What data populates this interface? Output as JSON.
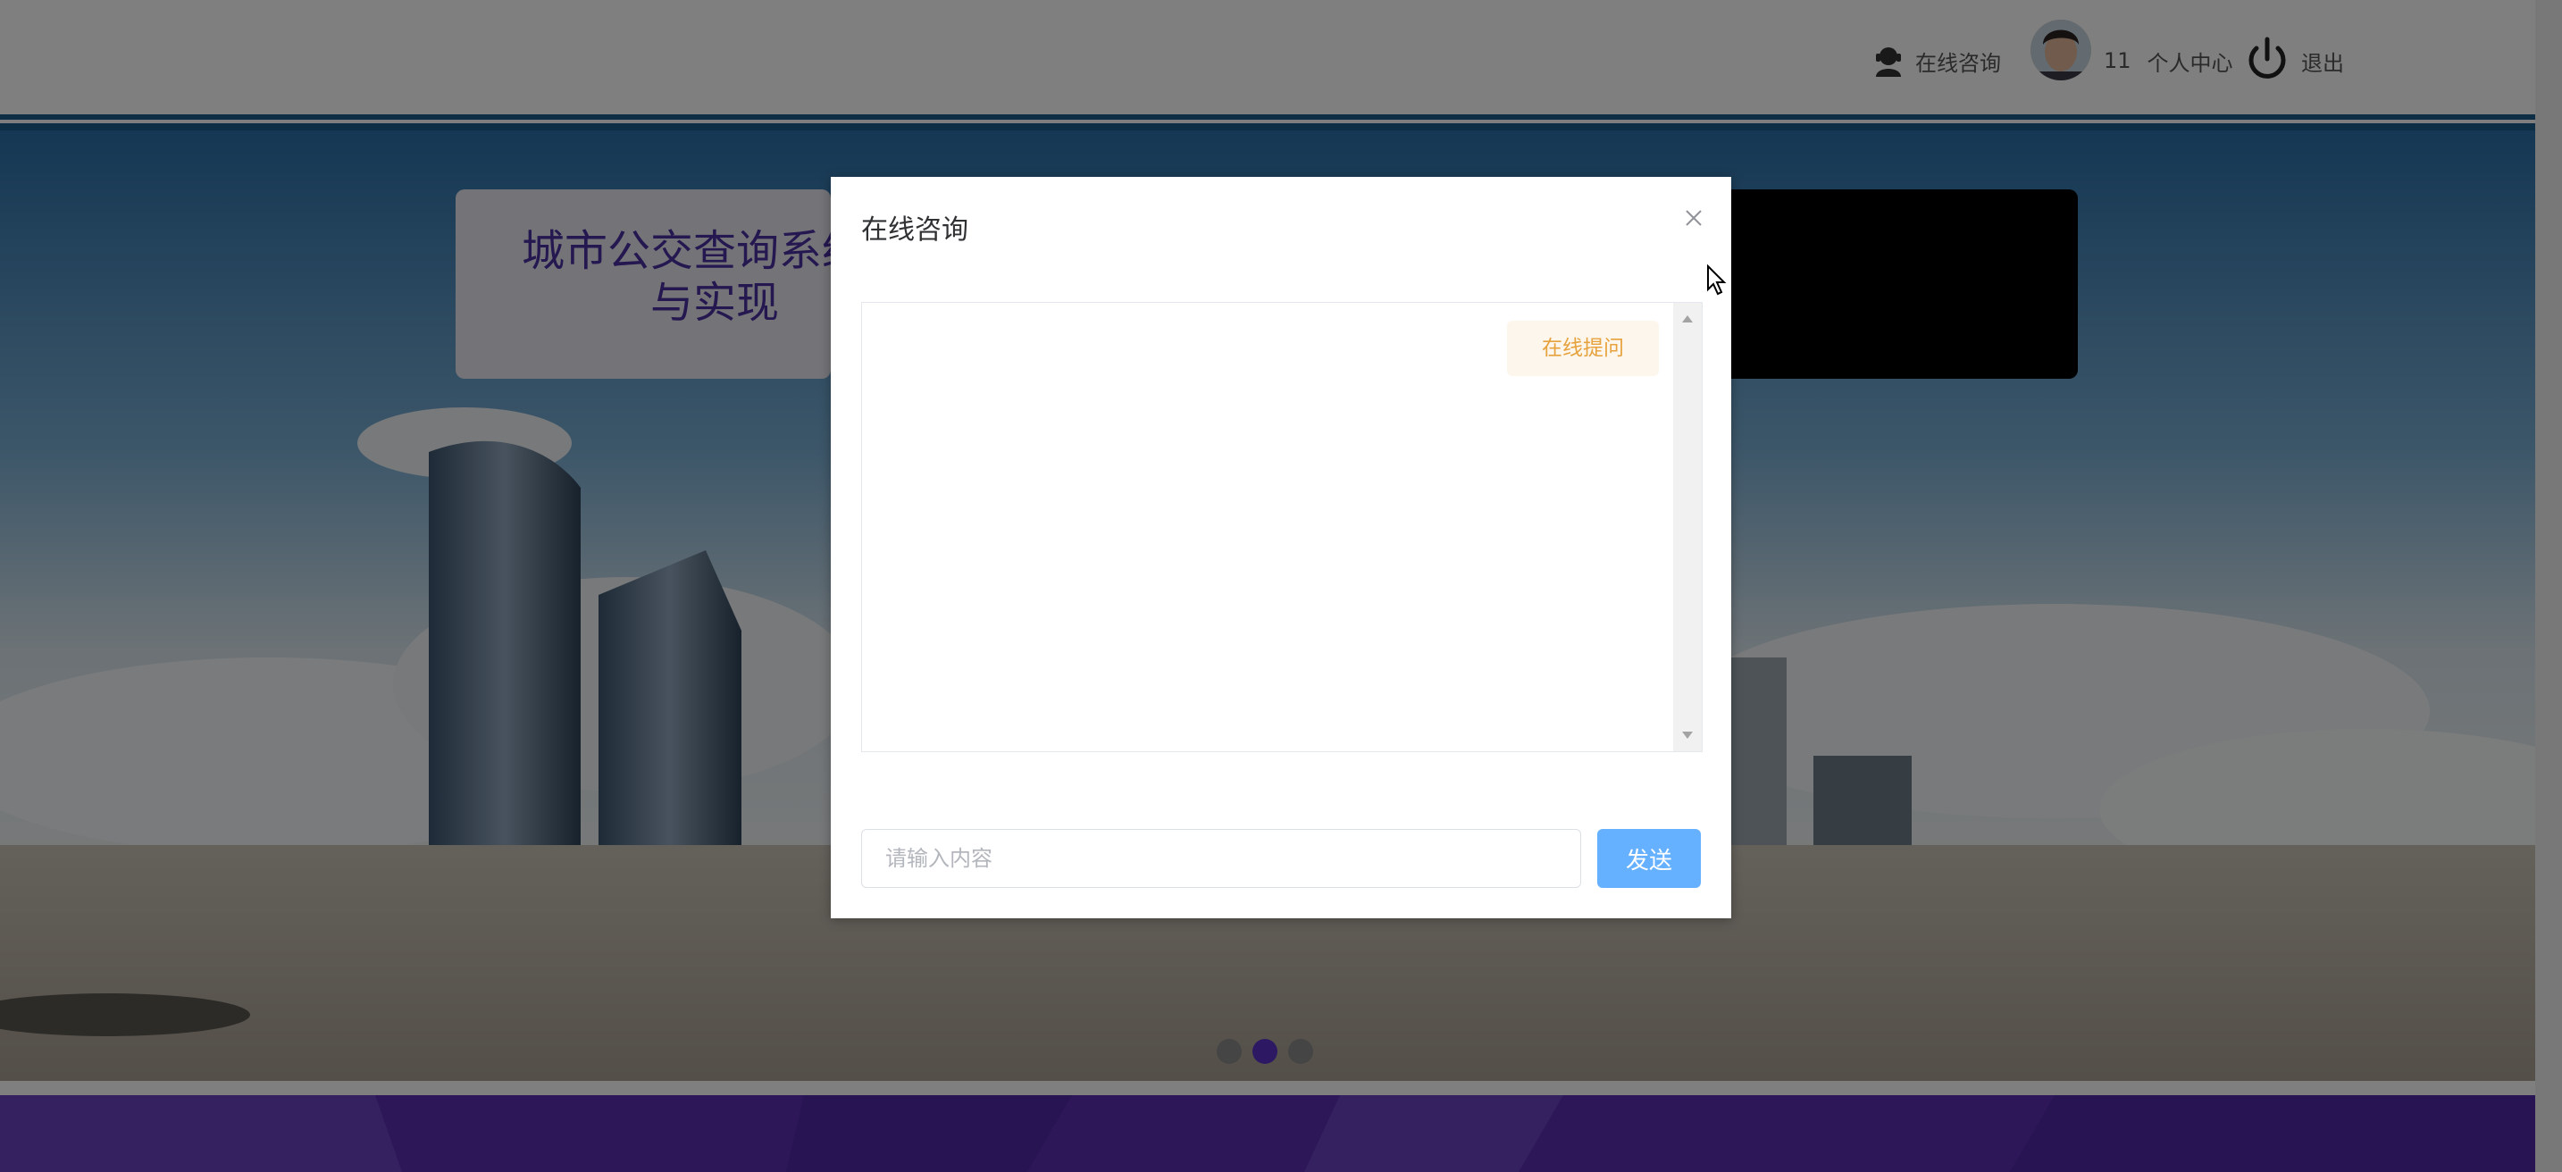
{
  "header": {
    "consult_label": "在线咨询",
    "username": "11",
    "profile_label": "个人中心",
    "logout_label": "退出"
  },
  "banner": {
    "title_line1": "城市公交查询系统的",
    "title_line2": "与实现",
    "slide_count": 3,
    "active_slide": 2
  },
  "dialog": {
    "title": "在线咨询",
    "messages": [
      {
        "text": "在线提问"
      }
    ],
    "input_placeholder": "请输入内容",
    "send_label": "发送"
  },
  "colors": {
    "header_line": "#1c5d8c",
    "title_text": "#4b2fa0",
    "active_dot": "#5a31c6",
    "footer": "#5b2eb2",
    "send_button": "#66b1ff",
    "bubble_bg": "#fdf6ec",
    "bubble_text": "#e6a23c"
  }
}
